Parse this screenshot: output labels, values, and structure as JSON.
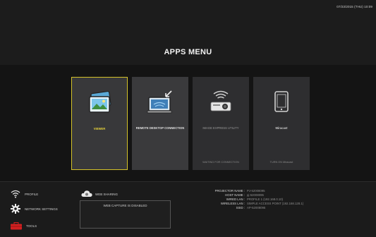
{
  "header": {
    "datetime": "07/23/2015 (THU) 10:09",
    "title": "APPS MENU"
  },
  "tiles": [
    {
      "label": "VIEWER",
      "status": "",
      "icon": "photo-icon",
      "selected": true
    },
    {
      "label": "REMOTE DESKTOP CONNECTION",
      "status": "",
      "icon": "remote-desktop-icon"
    },
    {
      "label": "IMAGE EXPRESS UTILITY",
      "status": "WAITING FOR CONNECTION",
      "icon": "projector-icon"
    },
    {
      "label": "Miracast",
      "status": "TURN ON Miracast",
      "icon": "tablet-icon"
    }
  ],
  "sidebar": {
    "profile": "PROFILE",
    "network_settings": "NETWORK SETTINGS",
    "tools": "TOOLS"
  },
  "web_sharing": {
    "label": "WEB SHARING",
    "capture_status": "WEB CAPTURE IS DISABLED"
  },
  "info": {
    "projector_name_label": "PROJECTOR NAME :",
    "projector_name": "PJ-52008095",
    "host_name_label": "HOST NAME :",
    "host_name": "pj-52008095",
    "wired_lan_label": "WIRED LAN :",
    "wired_lan": "PROFILE 1 (192.168.0.10)",
    "wireless_lan_label": "WIRELESS LAN :",
    "wireless_lan": "SIMPLE ACCESS POINT (192.168.128.1)",
    "ssid_label": "SSID :",
    "ssid": "AP-52008095"
  },
  "colors": {
    "selected_border": "#d4c229",
    "selected_label": "#e6d23a",
    "tools_icon": "#d22020"
  }
}
